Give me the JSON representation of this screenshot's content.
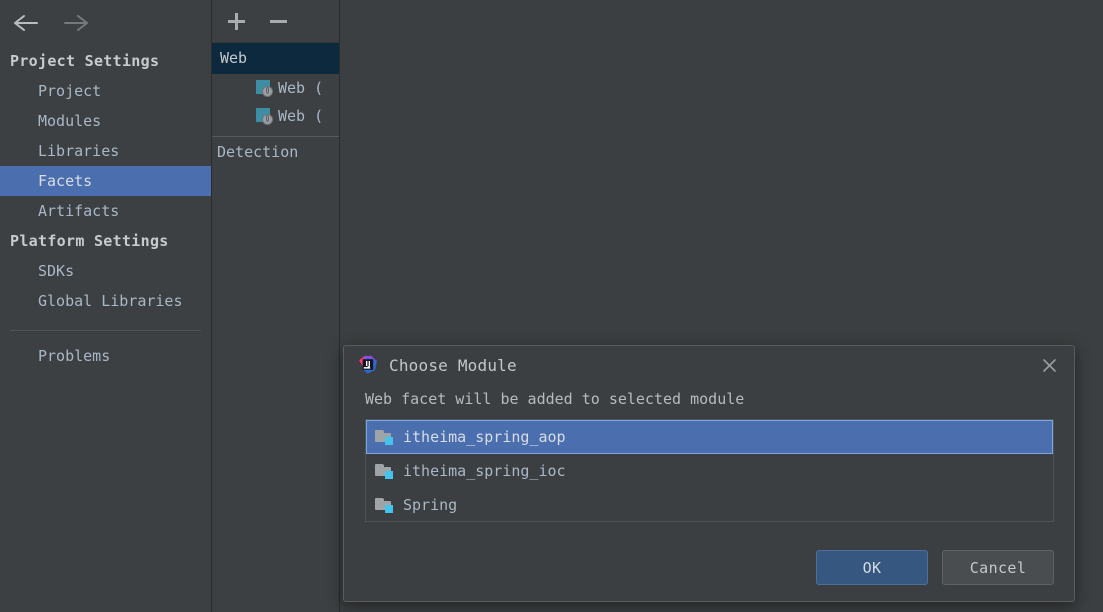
{
  "window": {
    "background": "#3c3f41"
  },
  "navigation": {
    "back_icon": "arrow-left-icon",
    "forward_icon": "arrow-right-icon"
  },
  "sidebar": {
    "groups": [
      {
        "label": "Project Settings",
        "items": [
          {
            "label": "Project",
            "selected": false
          },
          {
            "label": "Modules",
            "selected": false
          },
          {
            "label": "Libraries",
            "selected": false
          },
          {
            "label": "Facets",
            "selected": true
          },
          {
            "label": "Artifacts",
            "selected": false
          }
        ]
      },
      {
        "label": "Platform Settings",
        "items": [
          {
            "label": "SDKs",
            "selected": false
          },
          {
            "label": "Global Libraries",
            "selected": false
          }
        ]
      }
    ],
    "footer_items": [
      {
        "label": "Problems",
        "selected": false
      }
    ],
    "selection_color": "#4b6eaf"
  },
  "facet_panel": {
    "toolbar": {
      "add_label": "+",
      "remove_label": "−"
    },
    "tree": {
      "header": "Web",
      "children": [
        {
          "label": "Web (",
          "icon": "web-facet-icon"
        },
        {
          "label": "Web (",
          "icon": "web-facet-icon"
        }
      ],
      "section": "Detection"
    },
    "header_background": "#0d293e"
  },
  "dialog": {
    "title": "Choose Module",
    "logo_icon": "intellij-idea-logo-icon",
    "close_icon": "close-icon",
    "message": "Web facet will be added to selected module",
    "modules": [
      {
        "label": "itheima_spring_aop",
        "selected": true,
        "icon": "module-icon"
      },
      {
        "label": "itheima_spring_ioc",
        "selected": false,
        "icon": "module-icon"
      },
      {
        "label": "Spring",
        "selected": false,
        "icon": "module-icon"
      }
    ],
    "buttons": {
      "ok": "OK",
      "cancel": "Cancel"
    },
    "accent_color": "#365880",
    "selection_color": "#4b6eaf"
  }
}
